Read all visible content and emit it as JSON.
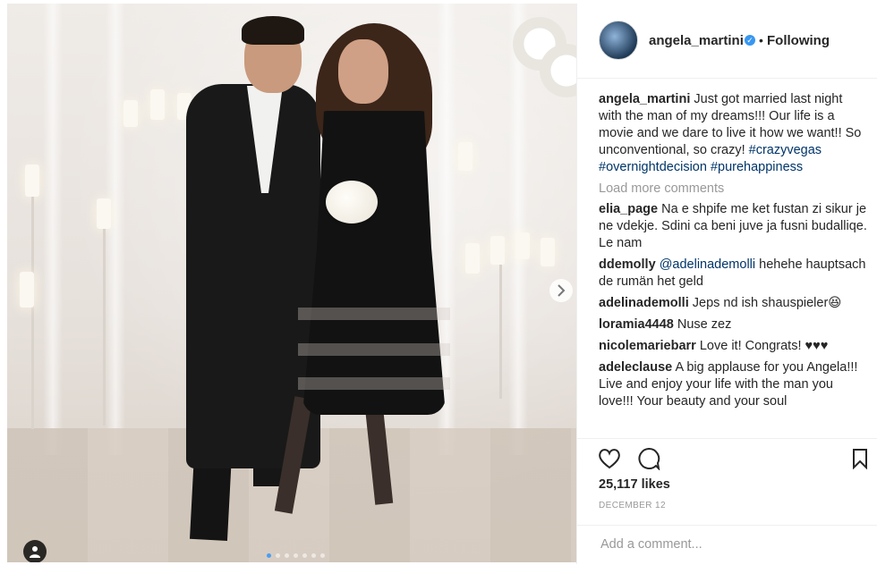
{
  "post": {
    "username": "angela_martini",
    "follow_status": "Following",
    "separator": "•",
    "verified_mark": "✓"
  },
  "caption": {
    "user": "angela_martini",
    "text": "Just got married last night with the man of my dreams!!! Our life is a movie and we dare to live it how we want!! So unconventional, so crazy!",
    "hashtags": [
      "#crazyvegas",
      "#overnightdecision",
      "#purehappiness"
    ]
  },
  "load_more_label": "Load more comments",
  "comments": [
    {
      "user": "elia_page",
      "text": "Na e shpife me ket fustan zi sikur je ne vdekje. Sdini ca beni juve ja fusni budalliqe. Le nam"
    },
    {
      "user": "ddemolly",
      "mention": "@adelinademolli",
      "text": "hehehe hauptsach de rumän het geld"
    },
    {
      "user": "adelinademolli",
      "text": "Jeps nd ish shauspieler😆"
    },
    {
      "user": "loramia4448",
      "text": "Nuse zez"
    },
    {
      "user": "nicolemariebarr",
      "text": "Love it! Congrats! ♥♥♥"
    },
    {
      "user": "adeleclause",
      "text": "A big applause for you Angela!!! Live and enjoy your life with the man you love!!! Your beauty and your soul"
    }
  ],
  "likes": "25,117 likes",
  "date": "DECEMBER 12",
  "add_comment_placeholder": "Add a comment...",
  "icons": {
    "like": "heart-icon",
    "comment": "comment-icon",
    "save": "bookmark-icon",
    "next": "chevron-right-icon",
    "tag": "user-tag-icon"
  },
  "colors": {
    "verified": "#3897f0",
    "link": "#003569",
    "muted": "#999999",
    "carousel_active_dot": "#4a9ef4"
  },
  "carousel": {
    "total_images": 7,
    "active_index": 1
  }
}
